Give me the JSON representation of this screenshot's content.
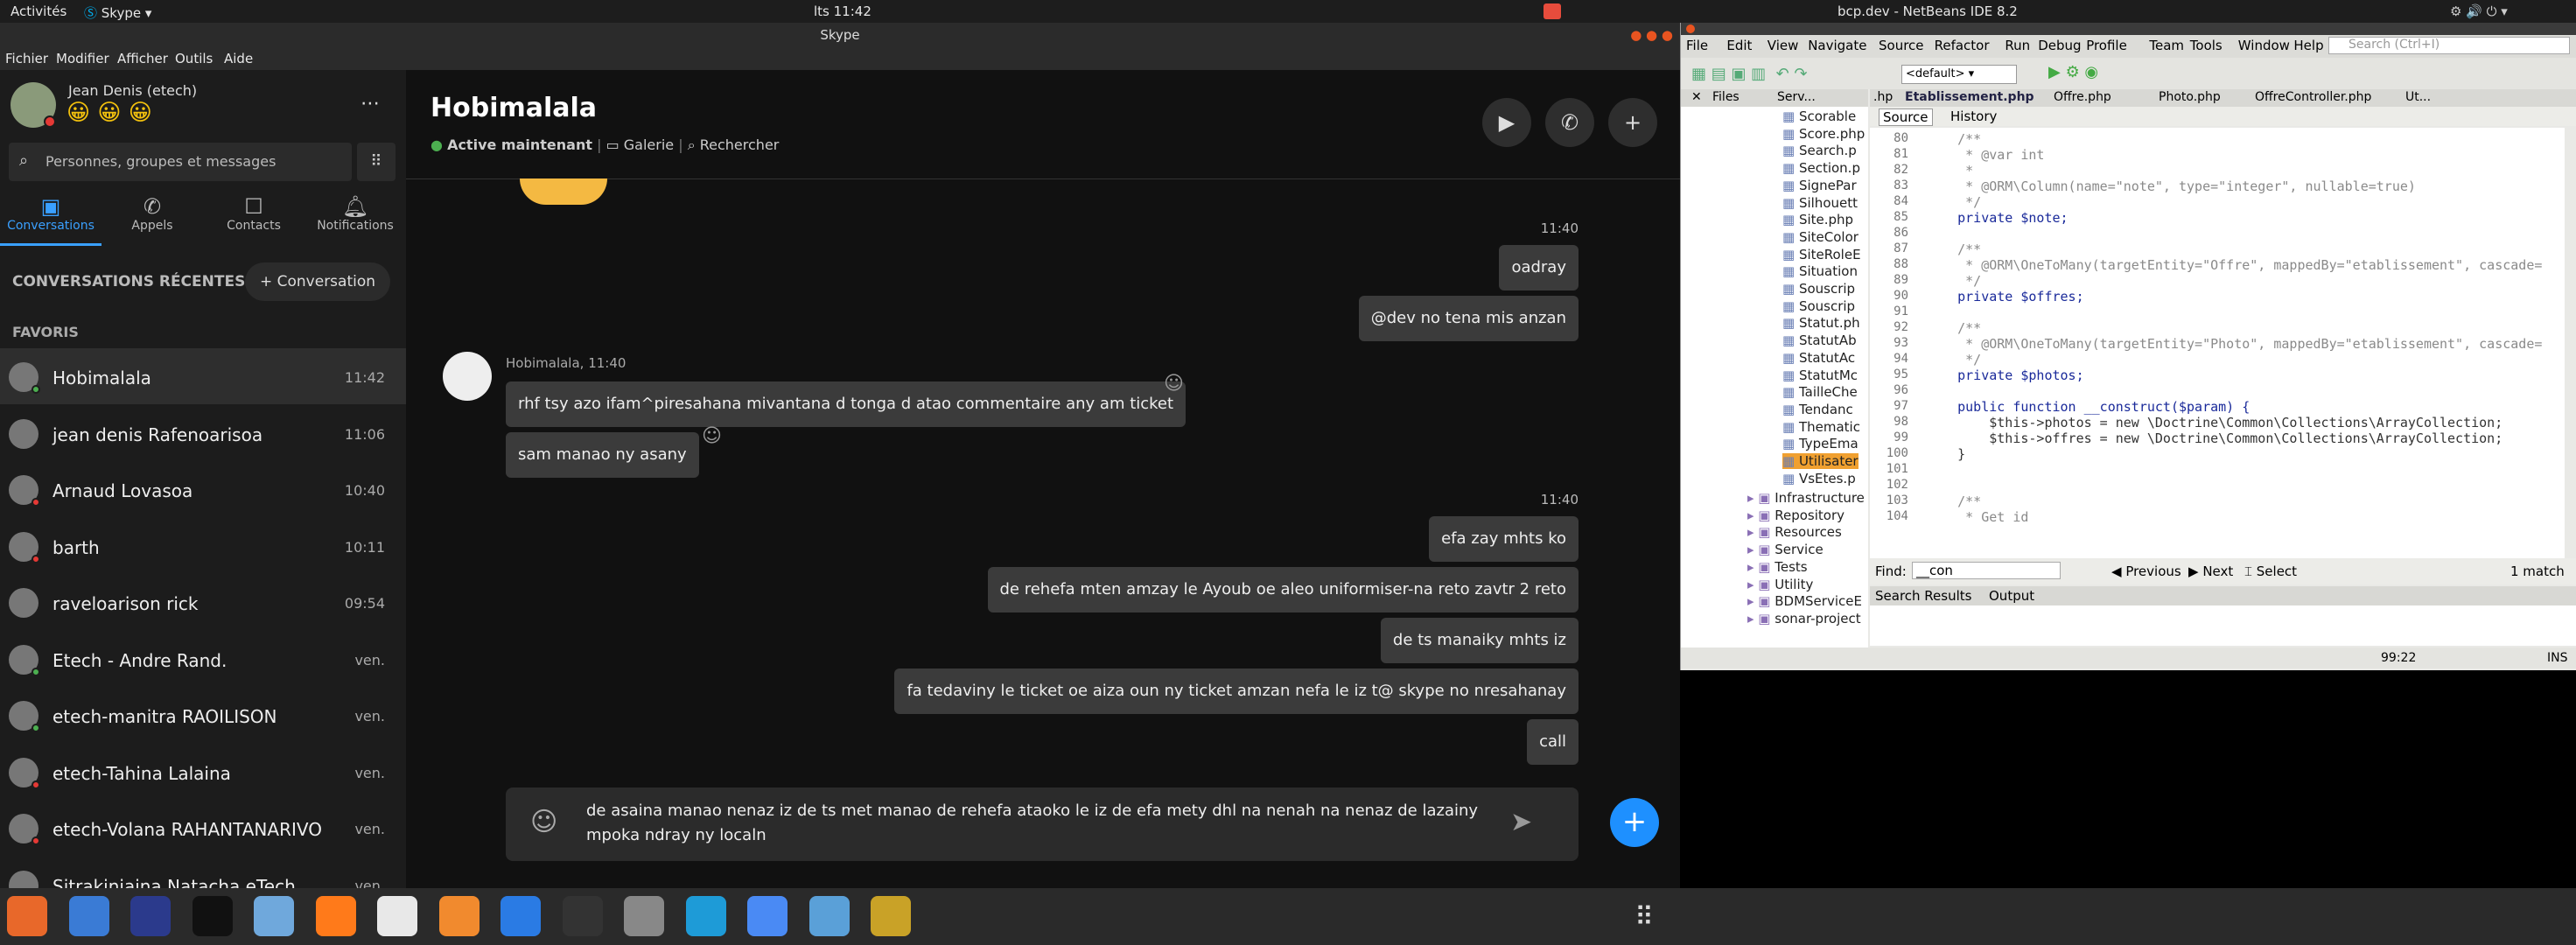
{
  "topbar": {
    "activities": "Activités",
    "app": "Skype",
    "clock": "lts 11:42",
    "skype_title": "Skype",
    "netbeans_title": "bcp.dev - NetBeans IDE 8.2"
  },
  "skype_menu": [
    "Fichier",
    "Modifier",
    "Afficher",
    "Outils",
    "Aide"
  ],
  "profile": {
    "name": "Jean Denis (etech)",
    "emojis": "😀 😀 😀"
  },
  "search": {
    "placeholder": "Personnes, groupes et messages"
  },
  "nav": [
    {
      "label": "Conversations",
      "icon": "chat-icon",
      "active": true
    },
    {
      "label": "Appels",
      "icon": "phone-icon"
    },
    {
      "label": "Contacts",
      "icon": "contacts-icon"
    },
    {
      "label": "Notifications",
      "icon": "bell-icon"
    }
  ],
  "recent_label": "CONVERSATIONS RÉCENTES",
  "new_conv": "Conversation",
  "favoris": "FAVORIS",
  "chats": [
    {
      "name": "Hobimalala",
      "time": "11:42",
      "status": "#4caf50",
      "selected": true
    },
    {
      "name": "jean denis Rafenoarisoa",
      "time": "11:06",
      "status": ""
    },
    {
      "name": "Arnaud Lovasoa",
      "time": "10:40",
      "status": "#e53935"
    },
    {
      "name": "barth",
      "time": "10:11",
      "status": "#e53935"
    },
    {
      "name": "raveloarison rick",
      "time": "09:54",
      "status": ""
    },
    {
      "name": "Etech - Andre Rand.",
      "time": "ven.",
      "status": "#4caf50"
    },
    {
      "name": "etech-manitra RAOILISON",
      "time": "ven.",
      "status": "#4caf50"
    },
    {
      "name": "etech-Tahina Lalaina",
      "time": "ven.",
      "status": "#e53935"
    },
    {
      "name": "etech-Volana RAHANTANARIVO",
      "time": "ven.",
      "status": "#e53935"
    },
    {
      "name": "Sitrakinjaina Natacha eTech",
      "time": "ven.",
      "status": ""
    }
  ],
  "header": {
    "name": "Hobimalala",
    "status": "Active maintenant",
    "gallery": "Galerie",
    "search": "Rechercher"
  },
  "messages": {
    "t1": "11:40",
    "m1": "oadray",
    "m2": "@dev no tena mis anzan",
    "sender": "Hobimalala, 11:40",
    "r1": "rhf tsy azo ifam^piresahana mivantana d tonga d atao commentaire any am ticket",
    "r2": "sam manao ny asany",
    "t2": "11:40",
    "m3": "efa zay mhts ko",
    "m4": "de rehefa mten amzay le Ayoub oe aleo uniformiser-na reto zavtr 2 reto",
    "m5": "de ts manaiky mhts iz",
    "m6": "fa tedaviny le ticket oe aiza oun ny ticket amzan nefa le iz t@ skype no nresahanay",
    "m7": "call"
  },
  "compose": {
    "text1": "de asaina manao nenaz iz de ts met manao de rehefa ataoko le iz de efa mety dhl na nenah na nenaz de lazainy",
    "text2": "mpoka ndray ny localn"
  },
  "netbeans": {
    "menu": [
      "File",
      "Edit",
      "View",
      "Navigate",
      "Source",
      "Refactor",
      "Run",
      "Debug",
      "Profile",
      "Team",
      "Tools",
      "Window",
      "Help"
    ],
    "search_placeholder": "Search (Ctrl+I)",
    "config": "<default>",
    "panel_tabs": [
      "Files",
      "Serv..."
    ],
    "editor_tabs": [
      ".hp",
      "Etablissement.php",
      "Offre.php",
      "Photo.php",
      "OffreController.php",
      "Ut..."
    ],
    "source": "Source",
    "history": "History",
    "files": [
      "Scorable",
      "Score.php",
      "Search.p",
      "Section.p",
      "SignePar",
      "Silhouett",
      "Site.php",
      "SiteColor",
      "SiteRoleE",
      "Situation",
      "Souscrip",
      "Souscrip",
      "Statut.ph",
      "StatutAb",
      "StatutAc",
      "StatutMc",
      "TailleChe",
      "Tendanc",
      "Thematic",
      "TypeEma",
      "Utilisater",
      "VsEtes.p"
    ],
    "folders": [
      "Infrastructure",
      "Repository",
      "Resources",
      "Service",
      "Tests",
      "Utility",
      "BDMServiceE",
      "sonar-project"
    ],
    "lines": [
      "80",
      "81",
      "82",
      "83",
      "84",
      "85",
      "86",
      "87",
      "88",
      "89",
      "90",
      "91",
      "92",
      "93",
      "94",
      "95",
      "96",
      "97",
      "98",
      "99",
      "100",
      "101",
      "102",
      "103",
      "104"
    ],
    "code": [
      "    /**",
      "     * @var int",
      "     *",
      "     * @ORM\\Column(name=\"note\", type=\"integer\", nullable=true)",
      "     */",
      "    private $note;",
      "",
      "    /**",
      "     * @ORM\\OneToMany(targetEntity=\"Offre\", mappedBy=\"etablissement\", cascade=",
      "     */",
      "    private $offres;",
      "",
      "    /**",
      "     * @ORM\\OneToMany(targetEntity=\"Photo\", mappedBy=\"etablissement\", cascade=",
      "     */",
      "    private $photos;",
      "",
      "    public function __construct($param) {",
      "        $this->photos = new \\Doctrine\\Common\\Collections\\ArrayCollection;",
      "        $this->offres = new \\Doctrine\\Common\\Collections\\ArrayCollection;",
      "    }",
      "",
      "",
      "    /**",
      "     * Get id"
    ],
    "find_label": "Find:",
    "find_value": "__con",
    "previous": "Previous",
    "next": "Next",
    "select": "Select",
    "match": "1 match",
    "bottom_tabs": [
      "Search Results",
      "Output"
    ],
    "status_pos": "99:22",
    "status_mode": "INS"
  },
  "dock_colors": [
    "#e8682a",
    "#3a7bd5",
    "#2b3a8c",
    "#111111",
    "#6fa8dc",
    "#ff7a1a",
    "#e8e8e8",
    "#f18a2e",
    "#2a7be4",
    "#333333",
    "#888888",
    "#1e9bd7",
    "#4a8af4",
    "#5aa0d8",
    "#c9a227"
  ]
}
